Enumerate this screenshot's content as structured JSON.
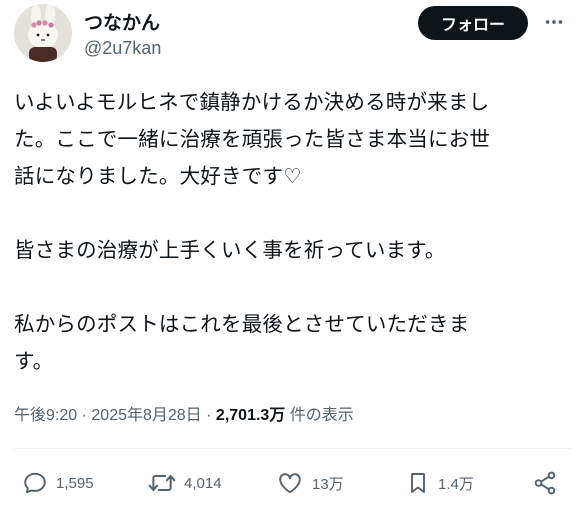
{
  "user": {
    "display_name": "つなかん",
    "handle": "@2u7kan",
    "avatar_icon": "bunny-doll-avatar"
  },
  "header": {
    "follow_label": "フォロー",
    "more_icon": "more-horizontal-icon"
  },
  "tweet": {
    "lines": [
      "いよいよモルヒネで鎮静かけるか決める時が来まし",
      "た。ここで一緒に治療を頑張った皆さま本当にお世",
      "話になりました。大好きです♡",
      "皆さまの治療が上手くいく事を祈っています。",
      "私からのポストはこれを最後とさせていただきま",
      "す。"
    ]
  },
  "meta": {
    "time": "午後9:20",
    "separator": "·",
    "date": "2025年8月28日",
    "views_count": "2,701.3万",
    "views_label": "件の表示"
  },
  "actions": {
    "replies": "1,595",
    "reposts": "4,014",
    "likes": "13万",
    "bookmarks": "1.4万"
  },
  "colors": {
    "text": "#0f1419",
    "secondary": "#536471",
    "button_bg": "#0f1419",
    "divider": "#eff3f4"
  }
}
